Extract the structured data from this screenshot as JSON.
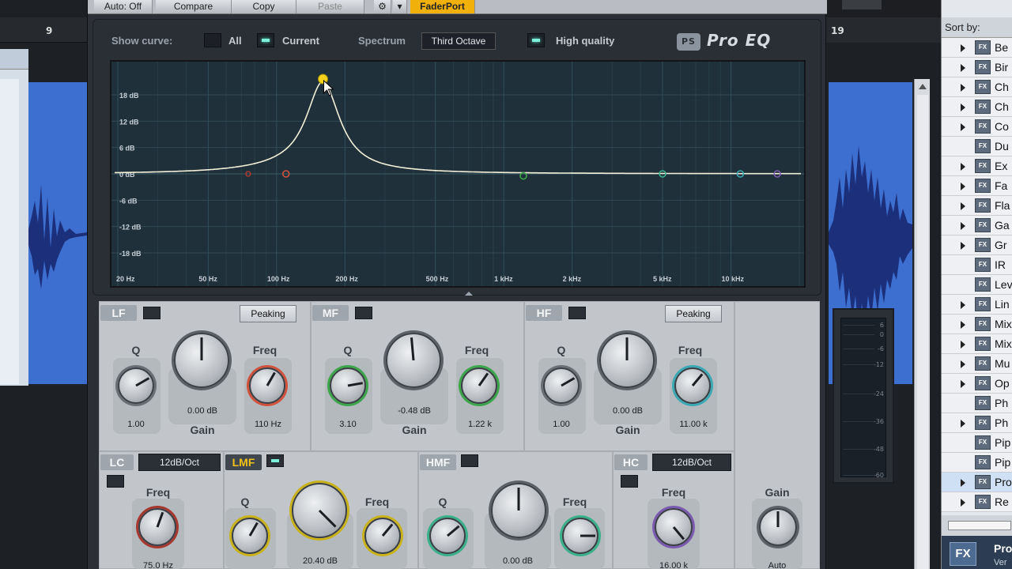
{
  "toolbar": {
    "auto": "Auto: Off",
    "compare": "Compare",
    "copy": "Copy",
    "paste": "Paste",
    "gear": "⚙",
    "dropdown": "▾",
    "faderport": "FaderPort"
  },
  "ruler": {
    "left_bar": "9",
    "right_bar": "19"
  },
  "header": {
    "show_curve": "Show curve:",
    "all": "All",
    "current": "Current",
    "spectrum": "Spectrum",
    "spectrum_value": "Third Octave",
    "high_quality": "High quality",
    "logo": "Pro EQ"
  },
  "graph": {
    "db_labels": [
      "18 dB",
      "12 dB",
      "6 dB",
      "0 dB",
      "-6 dB",
      "-12 dB",
      "-18 dB"
    ],
    "hz_labels": [
      "20 Hz",
      "50 Hz",
      "100 Hz",
      "200 Hz",
      "500 Hz",
      "1 kHz",
      "2 kHz",
      "5 kHz",
      "10 kHz"
    ],
    "colors": {
      "curve": "#f2f0d8",
      "peak_node": "#f4d21a",
      "lc_node": "#a6382f",
      "lf_node": "#d0523c",
      "mf_node": "#3ca64a",
      "hmf_node": "#3bb18a",
      "hf_node": "#3aa9b3",
      "hc_node": "#7b5bb0"
    }
  },
  "lf": {
    "tag": "LF",
    "mode": "Peaking",
    "q_label": "Q",
    "q_value": "1.00",
    "gain_value": "0.00 dB",
    "gain_label": "Gain",
    "freq_label": "Freq",
    "freq_value": "110 Hz"
  },
  "mf": {
    "tag": "MF",
    "q_label": "Q",
    "q_value": "3.10",
    "gain_value": "-0.48 dB",
    "gain_label": "Gain",
    "freq_label": "Freq",
    "freq_value": "1.22 k"
  },
  "hf": {
    "tag": "HF",
    "mode": "Peaking",
    "q_label": "Q",
    "q_value": "1.00",
    "gain_value": "0.00 dB",
    "gain_label": "Gain",
    "freq_label": "Freq",
    "freq_value": "11.00 k"
  },
  "lc": {
    "tag": "LC",
    "slope": "12dB/Oct",
    "freq_label": "Freq",
    "freq_value": "75.0 Hz"
  },
  "lmf": {
    "tag": "LMF",
    "q_label": "Q",
    "gain_value": "20.40 dB",
    "freq_label": "Freq"
  },
  "hmf": {
    "tag": "HMF",
    "q_label": "Q",
    "gain_value": "0.00 dB",
    "freq_label": "Freq"
  },
  "hc": {
    "tag": "HC",
    "slope": "12dB/Oct",
    "freq_label": "Freq",
    "freq_value": "16.00 k"
  },
  "output": {
    "gain_label": "Gain",
    "auto": "Auto",
    "meter_ticks": [
      "6",
      "0",
      "-6",
      "-12",
      "-24",
      "-36",
      "-48",
      "-60"
    ]
  },
  "browser": {
    "sort_by": "Sort by:",
    "fx_badge": "FX",
    "items": [
      {
        "name": "Be",
        "expand": true
      },
      {
        "name": "Bir",
        "expand": true
      },
      {
        "name": "Ch",
        "expand": true
      },
      {
        "name": "Ch",
        "expand": true
      },
      {
        "name": "Co",
        "expand": true
      },
      {
        "name": "Du",
        "expand": false
      },
      {
        "name": "Ex",
        "expand": true
      },
      {
        "name": "Fa",
        "expand": true
      },
      {
        "name": "Fla",
        "expand": true
      },
      {
        "name": "Ga",
        "expand": true
      },
      {
        "name": "Gr",
        "expand": true
      },
      {
        "name": "IR",
        "expand": false
      },
      {
        "name": "Lev",
        "expand": false
      },
      {
        "name": "Lin",
        "expand": true
      },
      {
        "name": "Mix",
        "expand": true
      },
      {
        "name": "Mix",
        "expand": true
      },
      {
        "name": "Mu",
        "expand": true
      },
      {
        "name": "Op",
        "expand": true
      },
      {
        "name": "Ph",
        "expand": false
      },
      {
        "name": "Ph",
        "expand": true
      },
      {
        "name": "Pip",
        "expand": false
      },
      {
        "name": "Pip",
        "expand": false
      },
      {
        "name": "Pro",
        "expand": true,
        "selected": true
      },
      {
        "name": "Re",
        "expand": true
      }
    ],
    "info_badge": "FX",
    "info_title": "Pro",
    "info_sub": "Ver"
  }
}
